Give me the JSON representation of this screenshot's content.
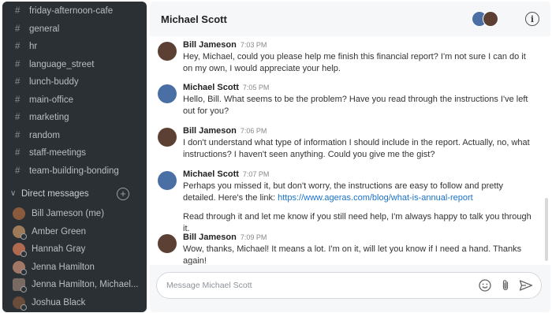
{
  "sidebar": {
    "channels": [
      {
        "label": "friday-afternoon-cafe"
      },
      {
        "label": "general"
      },
      {
        "label": "hr"
      },
      {
        "label": "language_street"
      },
      {
        "label": "lunch-buddy"
      },
      {
        "label": "main-office"
      },
      {
        "label": "marketing"
      },
      {
        "label": "random"
      },
      {
        "label": "staff-meetings"
      },
      {
        "label": "team-building-bonding"
      }
    ],
    "dm_header": "Direct messages",
    "direct_messages": [
      {
        "label": "Bill Jameson (me)",
        "color": "#8a5a3c"
      },
      {
        "label": "Amber Green",
        "color": "#9c7a5a"
      },
      {
        "label": "Hannah Gray",
        "color": "#b06a50"
      },
      {
        "label": "Jenna Hamilton",
        "color": "#a27766"
      },
      {
        "label": "Jenna Hamilton, Michael...",
        "color": "#7a6a64"
      },
      {
        "label": "Joshua Black",
        "color": "#6a4c3a"
      }
    ]
  },
  "header": {
    "title": "Michael Scott"
  },
  "messages": [
    {
      "name": "Bill Jameson",
      "time": "7:03 PM",
      "text": "Hey, Michael, could you please help me finish this financial report? I'm not sure I can do it on my own, I would appreciate your help.",
      "avatar_color": "#5c4033"
    },
    {
      "name": "Michael Scott",
      "time": "7:05 PM",
      "text": "Hello, Bill. What seems to be the problem? Have you read through the instructions I've left out for you?",
      "avatar_color": "#4a6fa5"
    },
    {
      "name": "Bill Jameson",
      "time": "7:06 PM",
      "text": "I don't understand what type of information I should include in the report. Actually, no, what instructions? I haven't seen anything. Could you give me the gist?",
      "avatar_color": "#5c4033"
    },
    {
      "name": "Michael Scott",
      "time": "7:07 PM",
      "text": "Perhaps you missed it, but don't worry, the instructions are easy to follow and pretty detailed. Here's the link: ",
      "link": "https://www.ageras.com/blog/what-is-annual-report",
      "followup": "Read through it and let me know if you still need help, I'm always happy to talk you through it.",
      "avatar_color": "#4a6fa5"
    },
    {
      "name": "Bill Jameson",
      "time": "7:09 PM",
      "text": "Wow, thanks, Michael! It means a lot. I'm on it, will let you know if I need a hand. Thanks again!",
      "avatar_color": "#5c4033"
    }
  ],
  "composer": {
    "placeholder": "Message Michael Scott"
  }
}
